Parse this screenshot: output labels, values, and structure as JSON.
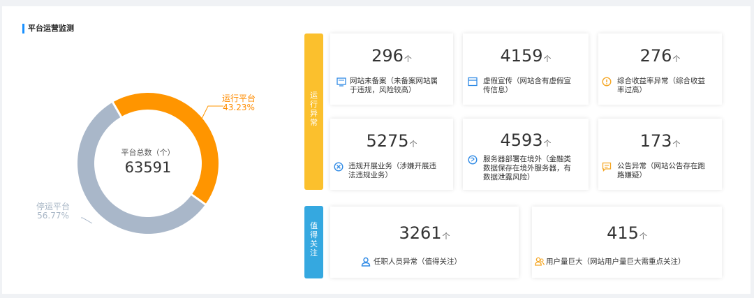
{
  "section_title": "平台运营监测",
  "donut": {
    "center_label": "平台总数（个）",
    "center_value": "63591",
    "running": {
      "label": "运行平台",
      "percent": "43.23%",
      "fraction": 0.4323,
      "color": "#ff9500"
    },
    "stopped": {
      "label": "停运平台",
      "percent": "56.77%",
      "fraction": 0.5677,
      "color": "#a9b7c9"
    }
  },
  "tabs": {
    "anomaly": [
      "运",
      "行",
      "异",
      "常"
    ],
    "attention": [
      "值",
      "得",
      "关",
      "注"
    ]
  },
  "unit": "个",
  "cards": [
    {
      "value": "296",
      "desc": [
        "网站未备案（未备案网站属",
        "于违规，风险较高）"
      ],
      "icon": "monitor-icon"
    },
    {
      "value": "4159",
      "desc": [
        "虚假宣传（网站含有虚假宣",
        "传信息）"
      ],
      "icon": "window-icon"
    },
    {
      "value": "276",
      "desc": [
        "综合收益率异常（综合收益",
        "率过高）"
      ],
      "icon": "warning-icon"
    },
    {
      "value": "5275",
      "desc": [
        "违规开展业务（涉嫌开展违",
        "法违规业务）"
      ],
      "icon": "cross-circle-icon"
    },
    {
      "value": "4593",
      "desc": [
        "服务器部署在境外（金融类",
        "数据保存在境外服务器，有",
        "数据泄露风险）"
      ],
      "icon": "globe-icon"
    },
    {
      "value": "173",
      "desc": [
        "公告异常（网站公告存在跑",
        "路嫌疑）"
      ],
      "icon": "notice-icon"
    },
    {
      "value": "3261",
      "desc": [
        "任职人员异常（值得关注）"
      ],
      "icon": "person-icon"
    },
    {
      "value": "415",
      "desc": [
        "用户量巨大（网站用户量巨大需重点关注）"
      ],
      "icon": "users-icon"
    }
  ],
  "colors": {
    "accent_blue": "#1890ff",
    "icon_blue": "#2f8ae5",
    "icon_orange": "#f5a623"
  }
}
